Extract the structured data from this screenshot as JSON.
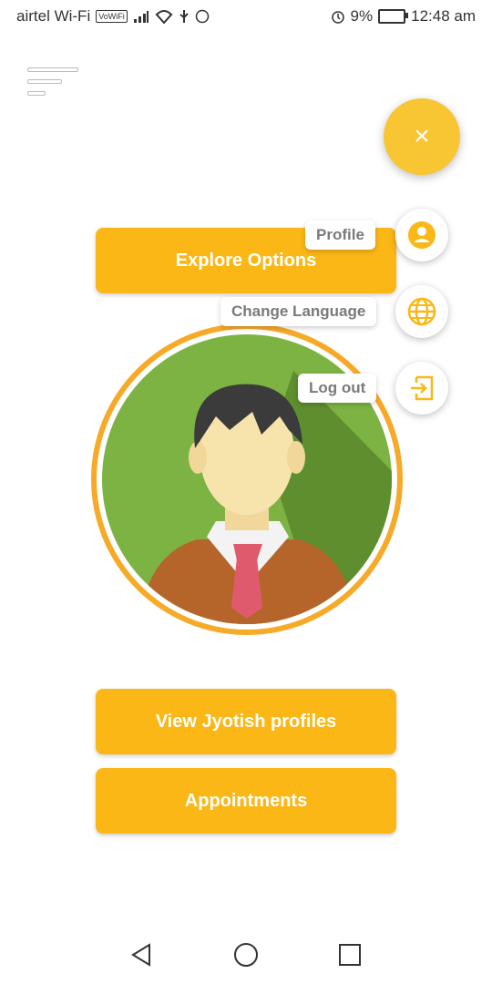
{
  "status_bar": {
    "carrier": "airtel Wi-Fi",
    "vowifi_badge": "VoWiFi",
    "battery": "9%",
    "time": "12:48 am"
  },
  "header": {
    "menu_icon": "menu-lines-icon"
  },
  "fab": {
    "icon": "close-icon",
    "symbol": "×",
    "color": "#f8c633"
  },
  "fab_menu": [
    {
      "label": "Profile",
      "icon": "person-icon"
    },
    {
      "label": "Change Language",
      "icon": "globe-icon"
    },
    {
      "label": "Log out",
      "icon": "exit-icon"
    }
  ],
  "buttons": {
    "explore": "Explore Options",
    "view_profiles": "View Jyotish profiles",
    "appointments": "Appointments"
  },
  "colors": {
    "accent": "#fbb716",
    "ring": "#f7a928",
    "avatar_bg": "#7cb342"
  },
  "nav": {
    "back": "back-triangle-icon",
    "home": "home-circle-icon",
    "recents": "recents-square-icon"
  }
}
